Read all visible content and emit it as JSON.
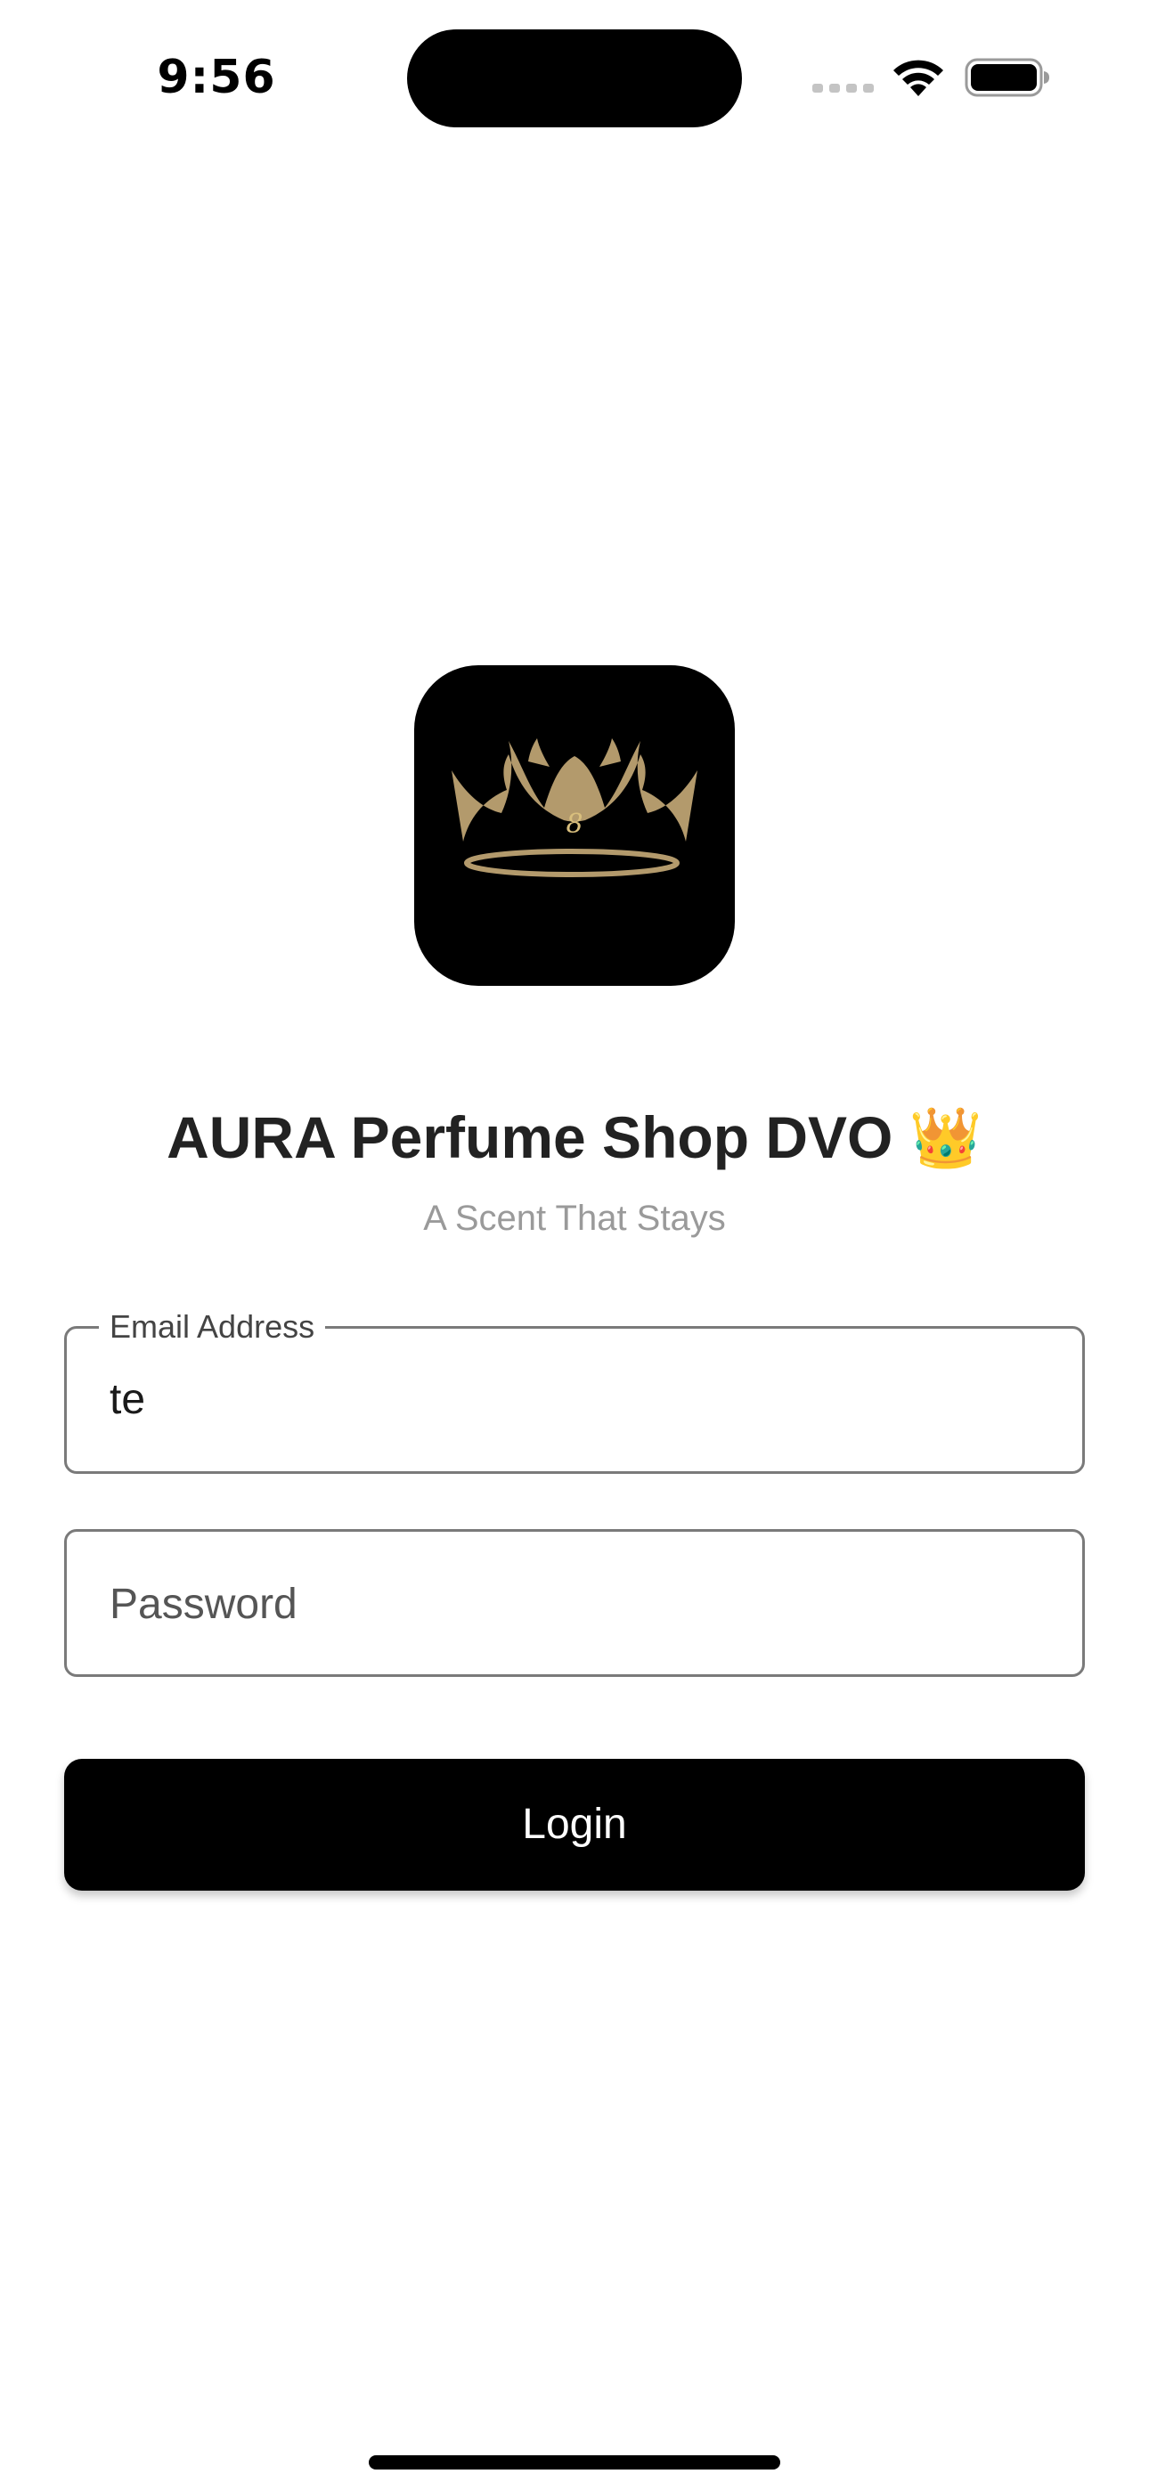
{
  "status_bar": {
    "time": "9:56"
  },
  "app": {
    "title": "AURA Perfume Shop DVO 👑",
    "subtitle": "A Scent That Stays",
    "logo_icon": "crown-icon",
    "logo_background": "#000000",
    "logo_accent": "#b39a6c"
  },
  "form": {
    "email": {
      "label": "Email Address",
      "value": "te"
    },
    "password": {
      "placeholder": "Password"
    },
    "login_label": "Login"
  },
  "colors": {
    "primary_button": "#000000",
    "button_text": "#ffffff",
    "subtitle_text": "#9a9a9a",
    "field_border": "#7a7a7a"
  }
}
